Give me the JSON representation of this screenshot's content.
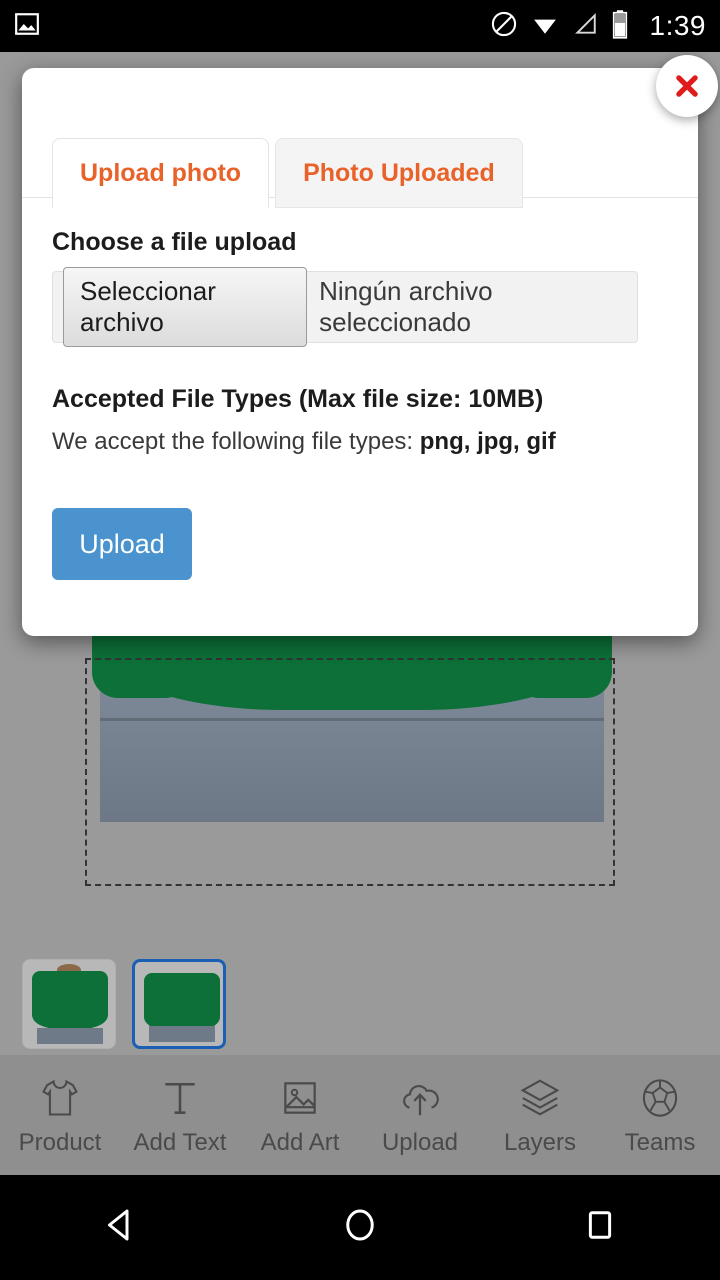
{
  "statusbar": {
    "time": "1:39",
    "icons": [
      "photo-icon",
      "do-not-disturb-icon",
      "wifi-icon",
      "cellular-signal-icon",
      "battery-icon"
    ]
  },
  "dialog": {
    "close_label": "✕",
    "tabs": [
      {
        "label": "Upload photo",
        "active": true
      },
      {
        "label": "Photo Uploaded",
        "active": false
      }
    ],
    "choose_file_label": "Choose a file upload",
    "file_input": {
      "button_label": "Seleccionar archivo",
      "status_text": "Ningún archivo seleccionado"
    },
    "accepted_title": "Accepted File Types (Max file size: 10MB)",
    "accepted_prefix": "We accept the following file types: ",
    "accepted_types": "png, jpg, gif",
    "upload_button": "Upload",
    "accent_color": "#e8622a",
    "button_color": "#4a93ce"
  },
  "editor": {
    "thumbnails": [
      {
        "name": "front-view",
        "selected": false
      },
      {
        "name": "back-view",
        "selected": true
      }
    ],
    "toolbar": [
      {
        "label": "Product",
        "icon": "tshirt-icon"
      },
      {
        "label": "Add Text",
        "icon": "text-icon"
      },
      {
        "label": "Add Art",
        "icon": "image-icon"
      },
      {
        "label": "Upload",
        "icon": "cloud-upload-icon"
      },
      {
        "label": "Layers",
        "icon": "layers-icon"
      },
      {
        "label": "Teams",
        "icon": "soccer-ball-icon"
      }
    ]
  },
  "navbar": {
    "back": "back-icon",
    "home": "home-icon",
    "recents": "recents-icon"
  }
}
